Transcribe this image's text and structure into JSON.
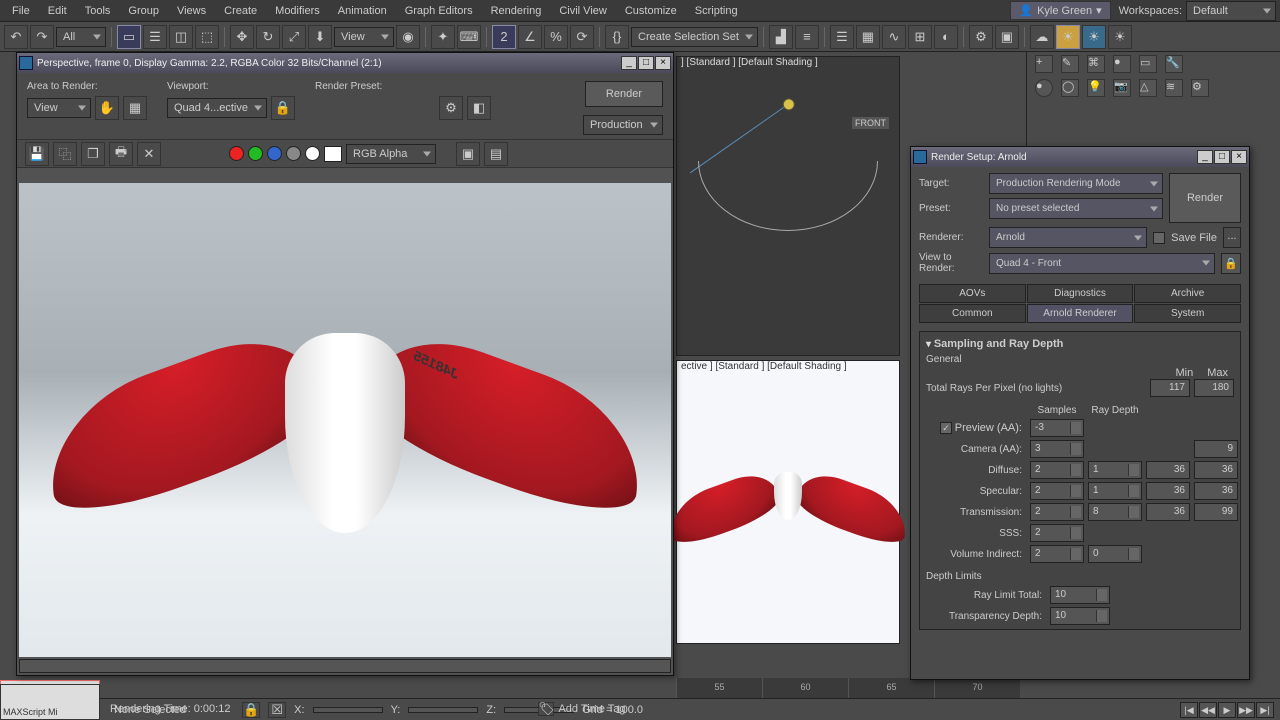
{
  "menu": {
    "items": [
      "File",
      "Edit",
      "Tools",
      "Group",
      "Views",
      "Create",
      "Modifiers",
      "Animation",
      "Graph Editors",
      "Rendering",
      "Civil View",
      "Customize",
      "Scripting"
    ]
  },
  "user": {
    "name": "Kyle Green"
  },
  "workspace": {
    "label": "Workspaces:",
    "value": "Default"
  },
  "toolbar": {
    "filter": "All",
    "view_label": "View",
    "create_sel": "Create Selection Set"
  },
  "render_window": {
    "title": "Perspective, frame 0, Display Gamma: 2.2, RGBA Color 32 Bits/Channel (2:1)",
    "area_label": "Area to Render:",
    "area_value": "View",
    "viewport_label": "Viewport:",
    "viewport_value": "Quad 4...ective",
    "preset_label": "Render Preset:",
    "preset_value": "Production",
    "render_btn": "Render",
    "channel_dropdown": "RGB Alpha",
    "registration": "J48155"
  },
  "vp_front": {
    "label": "] [Standard ] [Default Shading ]",
    "axis": "FRONT"
  },
  "vp_prev": {
    "label": "ective ] [Standard ] [Default Shading ]"
  },
  "render_setup": {
    "title": "Render Setup: Arnold",
    "target_lbl": "Target:",
    "target": "Production Rendering Mode",
    "preset_lbl": "Preset:",
    "preset": "No preset selected",
    "renderer_lbl": "Renderer:",
    "renderer": "Arnold",
    "savefile": "Save File",
    "ellipsis": "...",
    "view_lbl": "View to Render:",
    "view": "Quad 4 - Front",
    "render_btn": "Render",
    "tabs_a": [
      "AOVs",
      "Diagnostics",
      "Archive"
    ],
    "tabs_b": [
      "Common",
      "Arnold Renderer",
      "System"
    ],
    "section": "Sampling and Ray Depth",
    "general": "General",
    "min_lbl": "Min",
    "max_lbl": "Max",
    "total_rays": "Total Rays Per Pixel (no lights)",
    "total_min": "117",
    "total_max": "180",
    "col_samples": "Samples",
    "col_raydepth": "Ray Depth",
    "preview_lbl": "Preview (AA):",
    "preview_s": "-3",
    "camera_lbl": "Camera (AA):",
    "camera_s": "3",
    "camera_v2": "9",
    "diffuse_lbl": "Diffuse:",
    "diffuse_s": "2",
    "diffuse_d": "1",
    "diffuse_v1": "36",
    "diffuse_v2": "36",
    "specular_lbl": "Specular:",
    "specular_s": "2",
    "specular_d": "1",
    "specular_v1": "36",
    "specular_v2": "36",
    "trans_lbl": "Transmission:",
    "trans_s": "2",
    "trans_d": "8",
    "trans_v1": "36",
    "trans_v2": "99",
    "sss_lbl": "SSS:",
    "sss_s": "2",
    "vol_lbl": "Volume Indirect:",
    "vol_s": "2",
    "vol_d": "0",
    "depth_limits": "Depth Limits",
    "ray_limit_lbl": "Ray Limit Total:",
    "ray_limit": "10",
    "trans_depth_lbl": "Transparency Depth:",
    "trans_depth": "10"
  },
  "timeline": {
    "ticks": [
      "55",
      "60",
      "65",
      "70"
    ]
  },
  "status": {
    "none_selected": "None Selected",
    "rendering_time": "Rendering Time: 0:00:12",
    "x_lbl": "X:",
    "y_lbl": "Y:",
    "z_lbl": "Z:",
    "grid": "Grid = 100.0",
    "add_time_tag": "Add Time Tag",
    "maxscript": "MAXScript Mi"
  }
}
